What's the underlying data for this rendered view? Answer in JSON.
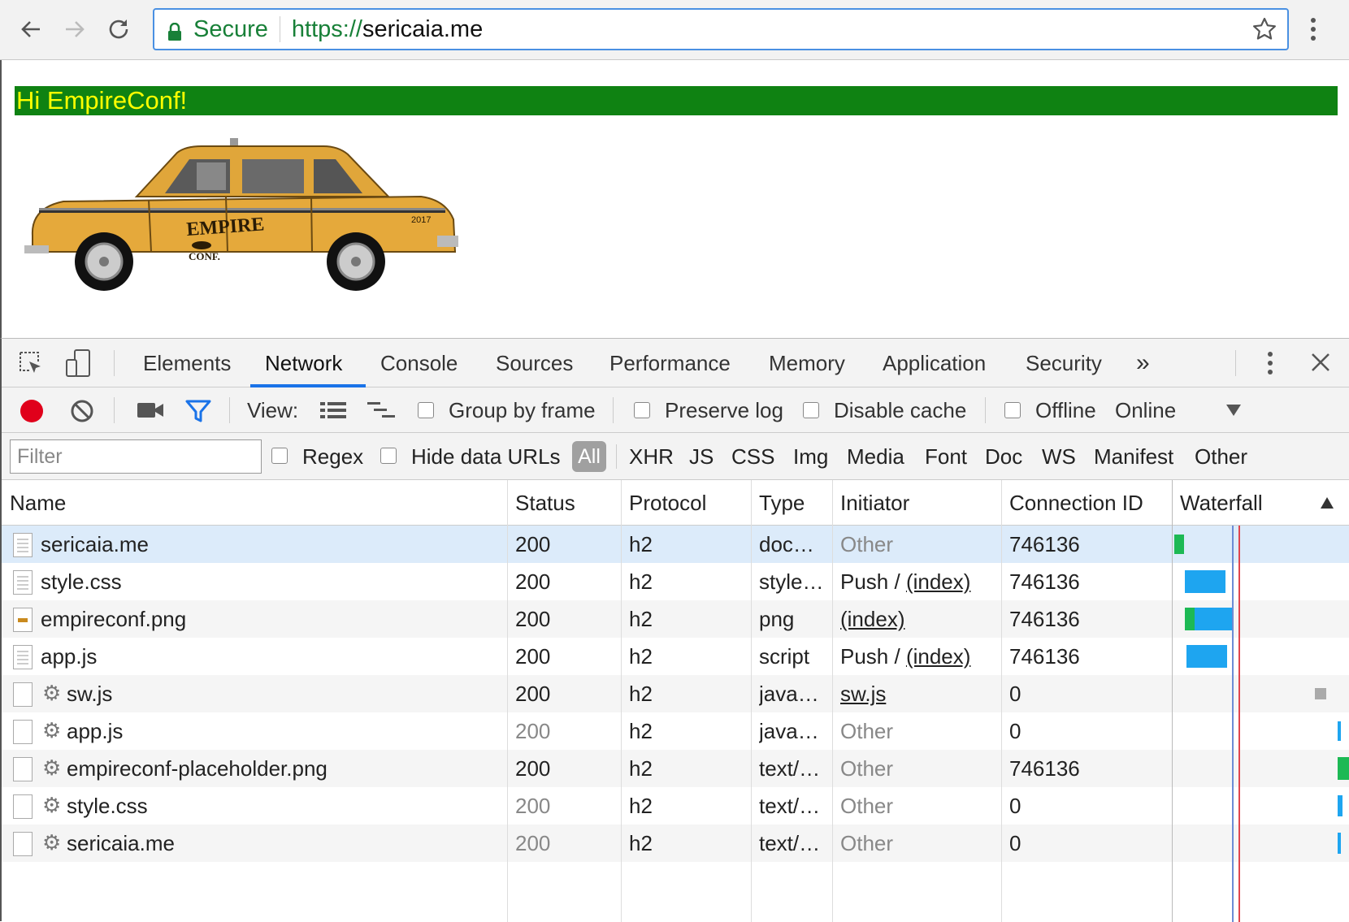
{
  "browser": {
    "secure_label": "Secure",
    "url_scheme": "https://",
    "url_host": "sericaia.me"
  },
  "page": {
    "greeting": "Hi EmpireConf!",
    "taxi_logo_text": "EMPIRE",
    "taxi_logo_sub": "CONF.",
    "taxi_year": "2017"
  },
  "devtools": {
    "tabs": [
      "Elements",
      "Network",
      "Console",
      "Sources",
      "Performance",
      "Memory",
      "Application",
      "Security"
    ],
    "active_tab": "Network",
    "more_tabs": "»",
    "toolbar": {
      "view_label": "View:",
      "group_by_frame": "Group by frame",
      "preserve_log": "Preserve log",
      "disable_cache": "Disable cache",
      "offline": "Offline",
      "throttle": "Online"
    },
    "filter": {
      "placeholder": "Filter",
      "regex": "Regex",
      "hide_data_urls": "Hide data URLs",
      "types": [
        "All",
        "XHR",
        "JS",
        "CSS",
        "Img",
        "Media",
        "Font",
        "Doc",
        "WS",
        "Manifest",
        "Other"
      ]
    },
    "columns": [
      "Name",
      "Status",
      "Protocol",
      "Type",
      "Initiator",
      "Connection ID",
      "Waterfall"
    ],
    "rows": [
      {
        "name": "sericaia.me",
        "status": "200",
        "protocol": "h2",
        "type": "doc…",
        "initiator": "Other",
        "conn": "746136",
        "sw": false
      },
      {
        "name": "style.css",
        "status": "200",
        "protocol": "h2",
        "type": "style…",
        "initiator": "Push / (index)",
        "conn": "746136",
        "sw": false
      },
      {
        "name": "empireconf.png",
        "status": "200",
        "protocol": "h2",
        "type": "png",
        "initiator": "(index)",
        "conn": "746136",
        "sw": false
      },
      {
        "name": "app.js",
        "status": "200",
        "protocol": "h2",
        "type": "script",
        "initiator": "Push / (index)",
        "conn": "746136",
        "sw": false
      },
      {
        "name": "sw.js",
        "status": "200",
        "protocol": "h2",
        "type": "java…",
        "initiator": "sw.js",
        "conn": "0",
        "sw": true
      },
      {
        "name": "app.js",
        "status": "200",
        "protocol": "h2",
        "type": "java…",
        "initiator": "Other",
        "conn": "0",
        "sw": true
      },
      {
        "name": "empireconf-placeholder.png",
        "status": "200",
        "protocol": "h2",
        "type": "text/…",
        "initiator": "Other",
        "conn": "746136",
        "sw": true
      },
      {
        "name": "style.css",
        "status": "200",
        "protocol": "h2",
        "type": "text/…",
        "initiator": "Other",
        "conn": "0",
        "sw": true
      },
      {
        "name": "sericaia.me",
        "status": "200",
        "protocol": "h2",
        "type": "text/…",
        "initiator": "Other",
        "conn": "0",
        "sw": true
      }
    ],
    "colors": {
      "accent": "#1a73e8",
      "record": "#e0001b",
      "filter_icon": "#1a73e8",
      "waterfall_blue": "#1ea5f0",
      "waterfall_green": "#1db954",
      "banner_bg": "#0f8212",
      "banner_text": "#ffff00"
    }
  }
}
